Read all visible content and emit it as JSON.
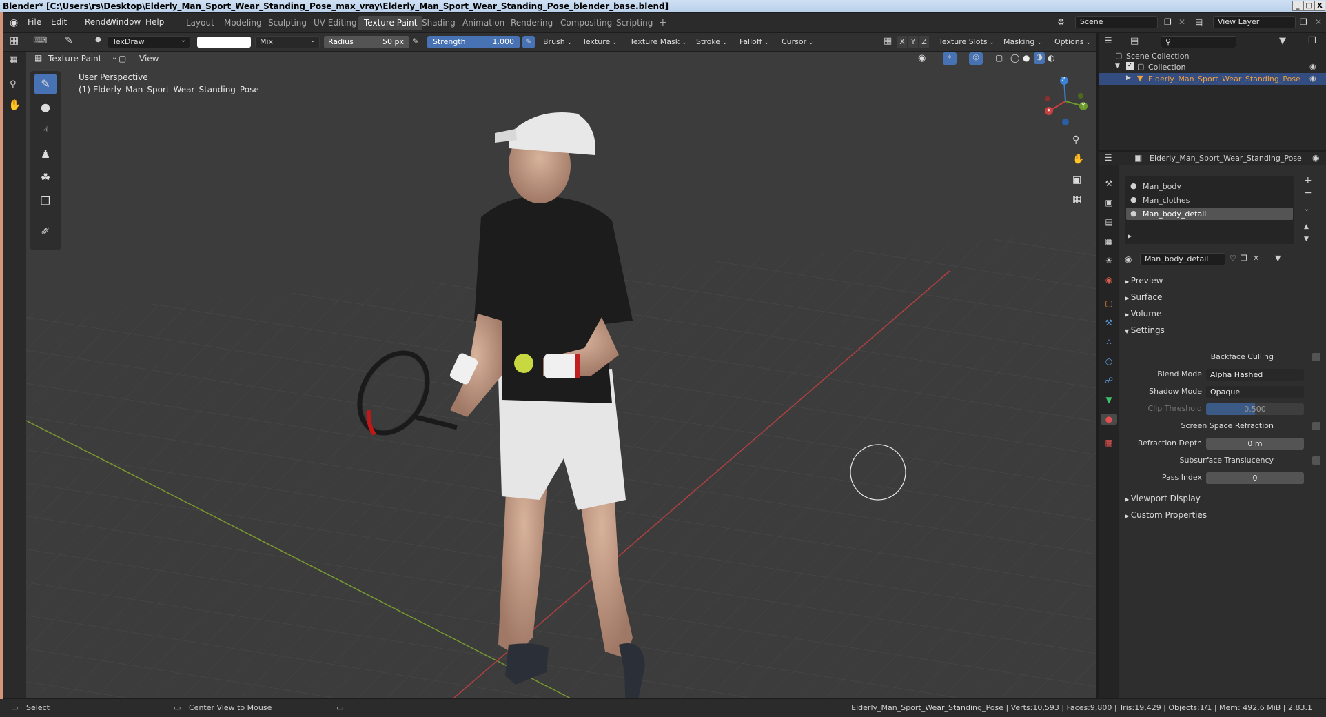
{
  "window": {
    "title": "Blender* [C:\\Users\\rs\\Desktop\\Elderly_Man_Sport_Wear_Standing_Pose_max_vray\\Elderly_Man_Sport_Wear_Standing_Pose_blender_base.blend]",
    "min": "_",
    "max": "□",
    "close": "X"
  },
  "menu": [
    "File",
    "Edit",
    "Render",
    "Window",
    "Help"
  ],
  "workspaces": [
    "Layout",
    "Modeling",
    "Sculpting",
    "UV Editing",
    "Texture Paint",
    "Shading",
    "Animation",
    "Rendering",
    "Compositing",
    "Scripting",
    "+"
  ],
  "active_workspace": "Texture Paint",
  "scene": {
    "label": "Scene",
    "view_layer": "View Layer"
  },
  "toolhdr": {
    "brush_name": "TexDraw",
    "blend": "Mix",
    "radius_label": "Radius",
    "radius_value": "50 px",
    "strength_label": "Strength",
    "strength_value": "1.000",
    "strength_fraction": 1.0,
    "menus": [
      "Brush",
      "Texture",
      "Texture Mask",
      "Stroke",
      "Falloff",
      "Cursor"
    ],
    "axes": [
      "X",
      "Y",
      "Z"
    ],
    "right_menus": [
      "Texture Slots",
      "Masking",
      "Options"
    ]
  },
  "vphdr": {
    "mode": "Texture Paint",
    "view": "View"
  },
  "viewport": {
    "perspective": "User Perspective",
    "object": "(1) Elderly_Man_Sport_Wear_Standing_Pose",
    "gizmo": {
      "x": "X",
      "y": "Y",
      "z": "Z"
    }
  },
  "outliner": {
    "root": "Scene Collection",
    "collection": "Collection",
    "object": "Elderly_Man_Sport_Wear_Standing_Pose"
  },
  "props": {
    "object_name": "Elderly_Man_Sport_Wear_Standing_Pose",
    "materials": [
      "Man_body",
      "Man_clothes",
      "Man_body_detail"
    ],
    "active_material": "Man_body_detail",
    "sections": [
      "Preview",
      "Surface",
      "Volume",
      "Settings"
    ],
    "settings": {
      "backface_culling": "Backface Culling",
      "blend_mode_label": "Blend Mode",
      "blend_mode": "Alpha Hashed",
      "shadow_mode_label": "Shadow Mode",
      "shadow_mode": "Opaque",
      "clip_label": "Clip Threshold",
      "clip_value": "0.500",
      "clip_fraction": 0.5,
      "ssr": "Screen Space Refraction",
      "refr_depth_label": "Refraction Depth",
      "refr_depth": "0 m",
      "subsurface": "Subsurface Translucency",
      "pass_index_label": "Pass Index",
      "pass_index": "0"
    },
    "more_sections": [
      "Viewport Display",
      "Custom Properties"
    ]
  },
  "status": {
    "select": "Select",
    "center": "Center View to Mouse",
    "info": "Elderly_Man_Sport_Wear_Standing_Pose | Verts:10,593 | Faces:9,800 | Tris:19,429 | Objects:1/1 | Mem: 492.6 MiB | 2.83.1"
  },
  "colors": {
    "accent": "#4772b3",
    "active_ws": "#474747",
    "x_axis": "#c9403f",
    "y_axis": "#6b9a2a",
    "z_axis": "#3b82d6",
    "object_orange": "#f0a040"
  }
}
